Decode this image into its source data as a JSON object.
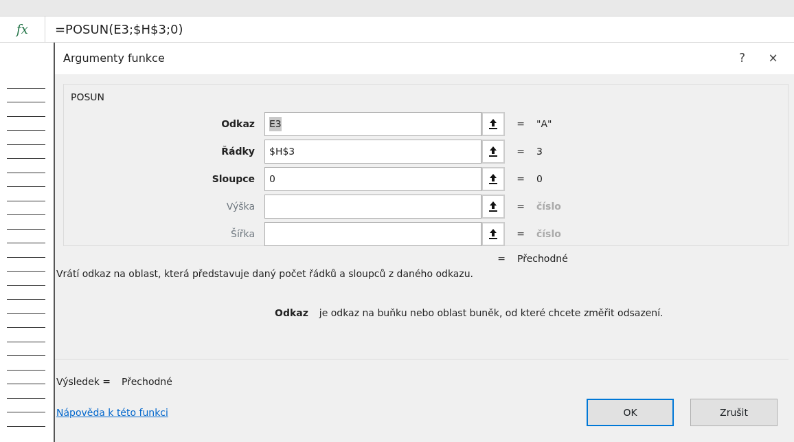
{
  "formula_bar": {
    "icon_text": "fx",
    "formula": "=POSUN(E3;$H$3;0)"
  },
  "dialog": {
    "title": "Argumenty funkce",
    "help_button": "?",
    "close_button": "×",
    "function_name": "POSUN",
    "arguments": [
      {
        "label": "Odkaz",
        "required": true,
        "value": "E3",
        "highlighted": true,
        "equals": "=",
        "result": "\"A\"",
        "hint": false
      },
      {
        "label": "Řádky",
        "required": true,
        "value": "$H$3",
        "highlighted": false,
        "equals": "=",
        "result": "3",
        "hint": false
      },
      {
        "label": "Sloupce",
        "required": true,
        "value": "0",
        "highlighted": false,
        "equals": "=",
        "result": "0",
        "hint": false
      },
      {
        "label": "Výška",
        "required": false,
        "equals": "=",
        "result": "číslo",
        "hint": true
      },
      {
        "label": "Šířka",
        "required": false,
        "equals": "=",
        "result": "číslo",
        "hint": true
      }
    ],
    "function_result_equals": "=",
    "function_result": "Přechodné",
    "description": "Vrátí odkaz na oblast, která představuje daný počet řádků a sloupců z daného odkazu.",
    "argument_help": {
      "name": "Odkaz",
      "text": "je odkaz na buňku nebo oblast buněk, od které chcete změřit odsazení."
    },
    "result_label": "Výsledek =",
    "result_value": "Přechodné",
    "help_link": "Nápověda k této funkci",
    "buttons": [
      {
        "label": "OK",
        "default": true
      },
      {
        "label": "Zrušit",
        "default": false
      }
    ]
  }
}
